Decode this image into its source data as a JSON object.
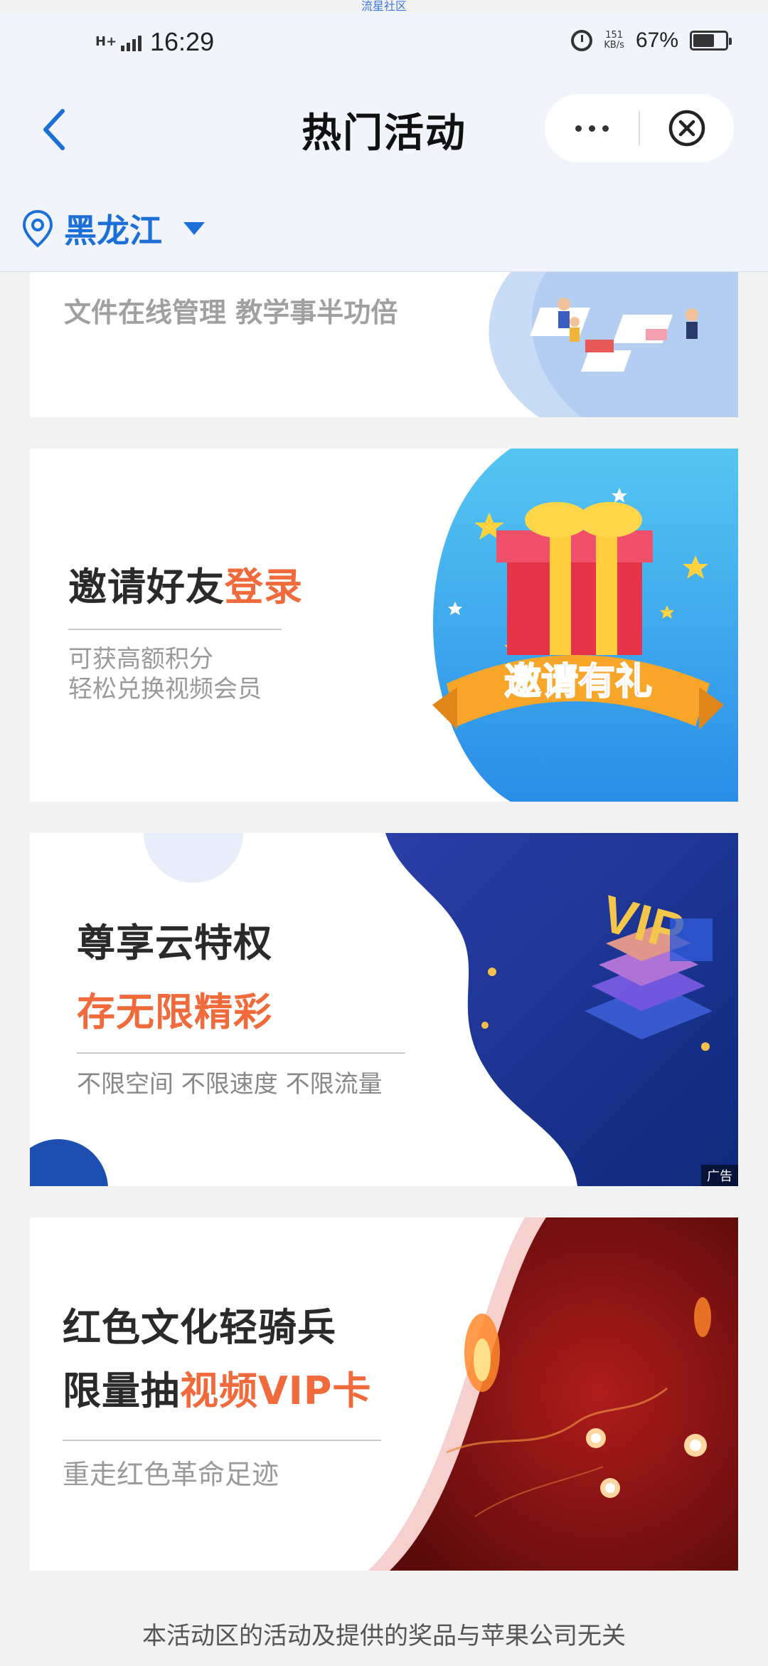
{
  "watermark": "流星社区",
  "status": {
    "network": "H+",
    "time": "16:29",
    "speed_value": "151",
    "speed_unit": "KB/s",
    "battery": "67%",
    "battery_level": 0.67
  },
  "nav": {
    "title": "热门活动",
    "back_icon": "chevron-left-icon",
    "more_icon": "more-dots-icon",
    "close_icon": "close-circle-icon"
  },
  "location": {
    "city": "黑龙江",
    "icon": "location-pin-icon"
  },
  "banners": [
    {
      "subtitle": "文件在线管理 教学事半功倍"
    },
    {
      "title_main": "邀请好友",
      "title_accent": "登录",
      "sub1": "可获高额积分",
      "sub2": "轻松兑换视频会员",
      "badge": "邀请有礼"
    },
    {
      "title": "尊享云特权",
      "accent": "存无限精彩",
      "sub": "不限空间 不限速度 不限流量",
      "vip": "VIP",
      "ad": "广告"
    },
    {
      "line1": "红色文化轻骑兵",
      "line2_main": "限量抽",
      "line2_accent": "视频VIP卡",
      "sub": "重走红色革命足迹"
    }
  ],
  "footer": "本活动区的活动及提供的奖品与苹果公司无关",
  "colors": {
    "accent_blue": "#1c6fd6",
    "accent_orange": "#f06a3c",
    "background": "#f2f2f2",
    "navbar_bg": "#f1f5fb"
  }
}
